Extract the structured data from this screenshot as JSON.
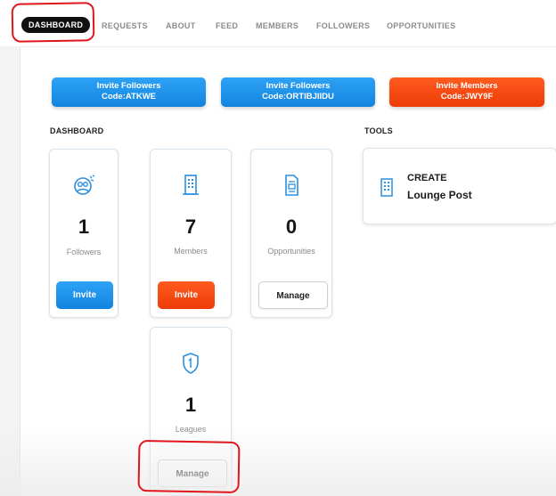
{
  "nav": {
    "items": [
      "DASHBOARD",
      "REQUESTS",
      "ABOUT",
      "FEED",
      "MEMBERS",
      "FOLLOWERS",
      "OPPORTUNITIES"
    ],
    "active": "DASHBOARD"
  },
  "invites": [
    {
      "line1": "Invite Followers",
      "line2": "Code:ATKWE",
      "color": "#1a8ee9"
    },
    {
      "line1": "Invite Followers",
      "line2": "Code:ORTIBJIIDU",
      "color": "#1a8ee9"
    },
    {
      "line1": "Invite Members",
      "line2": "Code:JWY9F",
      "color": "#f24810"
    }
  ],
  "dashboard": {
    "title": "DASHBOARD",
    "cards": [
      {
        "icon": "followers-icon",
        "count": "1",
        "label": "Followers",
        "button": "Invite"
      },
      {
        "icon": "building-icon",
        "count": "7",
        "label": "Members",
        "button": "Invite"
      },
      {
        "icon": "document-icon",
        "count": "0",
        "label": "Opportunities",
        "button": "Manage"
      },
      {
        "icon": "shield-icon",
        "count": "1",
        "label": "Leagues",
        "button": "Manage"
      }
    ]
  },
  "tools": {
    "title": "TOOLS",
    "create_label": "CREATE",
    "create_item": "Lounge Post",
    "icon": "building-icon"
  },
  "colors": {
    "accent_blue": "#1a8ee9",
    "accent_orange": "#f24810",
    "annotation_red": "#e0161b",
    "icon_blue": "#2a8fe0"
  }
}
